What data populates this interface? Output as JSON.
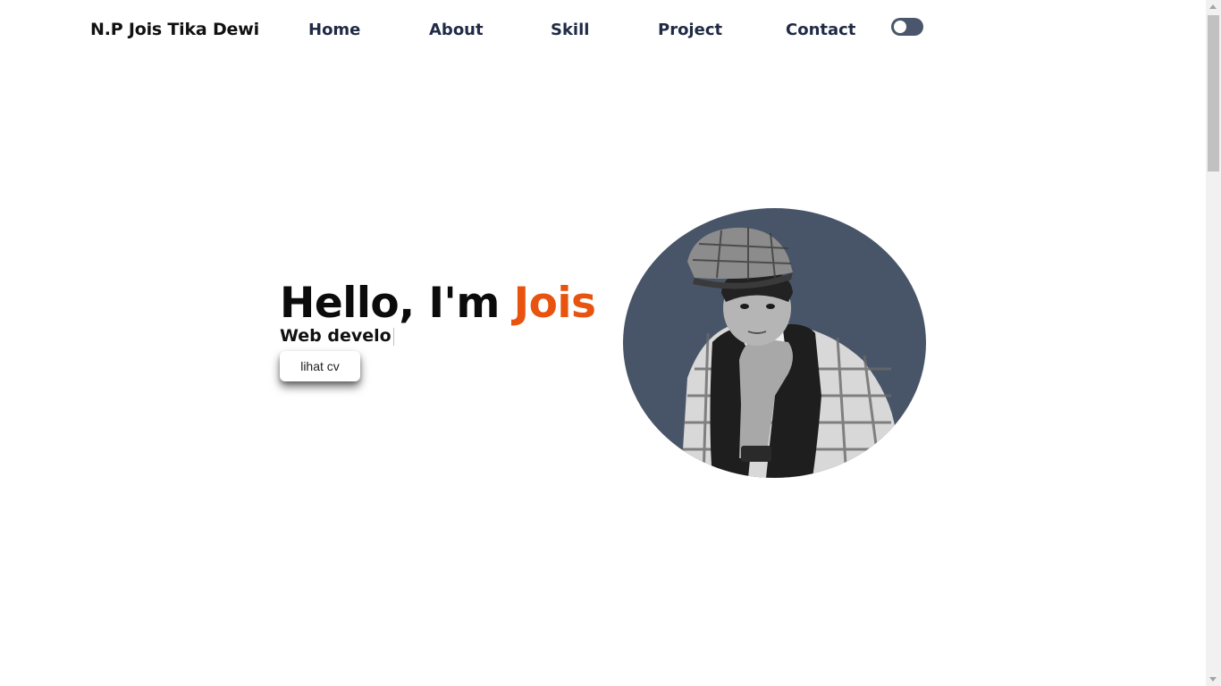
{
  "navbar": {
    "brand": "N.P Jois Tika Dewi",
    "links": [
      "Home",
      "About",
      "Skill",
      "Project",
      "Contact"
    ],
    "theme_toggle": {
      "state": "off"
    }
  },
  "hero": {
    "greeting": "Hello, I'm ",
    "name": "Jois",
    "subtitle": "Web develo",
    "cv_button": "lihat cv",
    "photo_icon": "profile-photo"
  },
  "colors": {
    "accent": "#e8540f",
    "nav_text": "#1f2a44",
    "photo_bg": "#485569",
    "toggle_bg": "#4a566b"
  }
}
